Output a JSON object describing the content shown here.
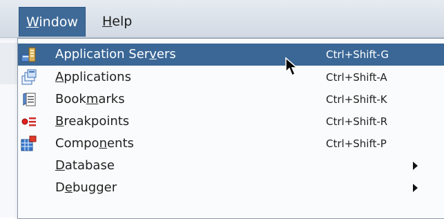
{
  "menubar": {
    "items": [
      {
        "before": "",
        "mnemonic": "W",
        "after": "indow",
        "active": true
      },
      {
        "before": "",
        "mnemonic": "H",
        "after": "elp",
        "active": false
      }
    ]
  },
  "dropdown": {
    "items": [
      {
        "before": "Application Ser",
        "mnemonic": "v",
        "after": "ers",
        "shortcut": "Ctrl+Shift-G",
        "icon": "application-servers-icon",
        "selected": true
      },
      {
        "before": "",
        "mnemonic": "A",
        "after": "pplications",
        "shortcut": "Ctrl+Shift-A",
        "icon": "applications-icon"
      },
      {
        "before": "Book",
        "mnemonic": "m",
        "after": "arks",
        "shortcut": "Ctrl+Shift-K",
        "icon": "bookmarks-icon"
      },
      {
        "before": "",
        "mnemonic": "B",
        "after": "reakpoints",
        "shortcut": "Ctrl+Shift-R",
        "icon": "breakpoints-icon"
      },
      {
        "before": "Compo",
        "mnemonic": "n",
        "after": "ents",
        "shortcut": "Ctrl+Shift-P",
        "icon": "components-icon"
      },
      {
        "before": "",
        "mnemonic": "D",
        "after": "atabase",
        "submenu": true
      },
      {
        "before": "D",
        "mnemonic": "e",
        "after": "bugger",
        "submenu": true
      }
    ]
  },
  "colors": {
    "selection": "#3a6796",
    "menu_active": "#3f6a98"
  }
}
